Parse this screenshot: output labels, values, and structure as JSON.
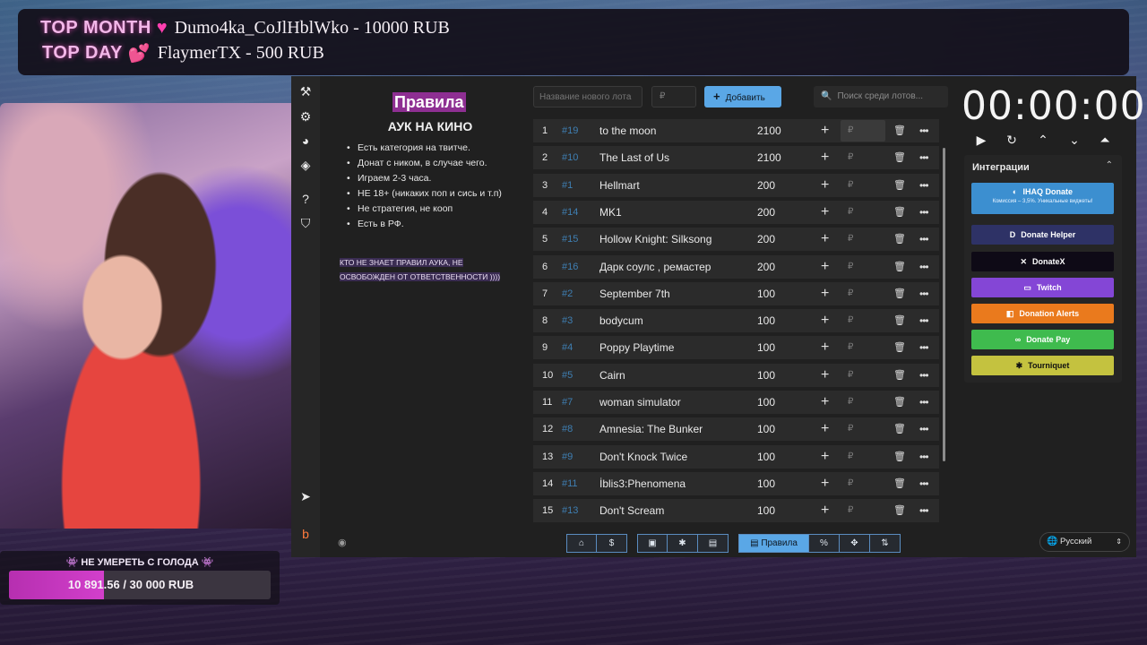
{
  "top_banner": {
    "month_label": "TOP MONTH",
    "month_value": "Dumo4ka_CoJlHblWko - 10000 RUB",
    "day_label": "TOP DAY",
    "day_value": "FlaymerTX - 500 RUB"
  },
  "goal": {
    "title": "👾 НЕ УМЕРЕТЬ С ГОЛОДА 👾",
    "amount_text": "10 891.56 / 30 000 RUB",
    "progress_fraction": 0.363
  },
  "rules": {
    "title": "Правила",
    "subtitle": "АУК НА КИНО",
    "items": [
      "Есть категория на твитче.",
      "Донат с ником, в случае чего.",
      "Играем 2-3 часа.",
      "НЕ 18+ (никаких поп и сись и т.п)",
      "Не стратегия, не кооп",
      "Есть в РФ."
    ],
    "note": "КТО НЕ ЗНАЕТ ПРАВИЛ АУКА, НЕ ОСВОБОЖДЕН ОТ ОТВЕТСТВЕННОСТИ ))))"
  },
  "controls": {
    "lot_name_placeholder": "Название нового лота",
    "lot_sum_placeholder": "₽",
    "add_label": "Добавить",
    "search_placeholder": "Поиск среди лотов..."
  },
  "lots": [
    {
      "index": "1",
      "id": "#19",
      "name": "to the moon",
      "amount": "2100"
    },
    {
      "index": "2",
      "id": "#10",
      "name": "The Last of Us",
      "amount": "2100"
    },
    {
      "index": "3",
      "id": "#1",
      "name": "Hellmart",
      "amount": "200"
    },
    {
      "index": "4",
      "id": "#14",
      "name": "MK1",
      "amount": "200"
    },
    {
      "index": "5",
      "id": "#15",
      "name": "Hollow Knight: Silksong",
      "amount": "200"
    },
    {
      "index": "6",
      "id": "#16",
      "name": "Дарк соулс , ремастер",
      "amount": "200"
    },
    {
      "index": "7",
      "id": "#2",
      "name": "September 7th",
      "amount": "100"
    },
    {
      "index": "8",
      "id": "#3",
      "name": "bodycum",
      "amount": "100"
    },
    {
      "index": "9",
      "id": "#4",
      "name": "Poppy Playtime",
      "amount": "100"
    },
    {
      "index": "10",
      "id": "#5",
      "name": "Cairn",
      "amount": "100"
    },
    {
      "index": "11",
      "id": "#7",
      "name": "woman simulator",
      "amount": "100"
    },
    {
      "index": "12",
      "id": "#8",
      "name": "Amnesia: The Bunker",
      "amount": "100"
    },
    {
      "index": "13",
      "id": "#9",
      "name": "Don't Knock Twice",
      "amount": "100"
    },
    {
      "index": "14",
      "id": "#11",
      "name": "İblis3:Phenomena",
      "amount": "100"
    },
    {
      "index": "15",
      "id": "#13",
      "name": "Don't Scream",
      "amount": "100"
    }
  ],
  "lot_row_labels": {
    "plus": "+",
    "currency": "₽",
    "delete_icon": "🗑",
    "more_icon": "•••"
  },
  "toolbar": {
    "github": "⌂",
    "dollar": "$",
    "save": "▣",
    "bug": "✱",
    "archive": "▤",
    "rules_label": "Правила",
    "percent": "%",
    "move": "✥",
    "sort": "⇅"
  },
  "timer": {
    "display": "00:00:00"
  },
  "integrations": {
    "title": "Интеграции",
    "ihaq_label": "IHAQ Donate",
    "ihaq_sub": "Комиссия – 3,5%. Уникальные виджеты!",
    "items": [
      "Donate Helper",
      "DonateX",
      "Twitch",
      "Donation Alerts",
      "Donate Pay",
      "Tourniquet"
    ]
  },
  "language": {
    "selected": "Русский"
  },
  "colors": {
    "accent_blue": "#5aa7e6",
    "rules_title_bg": "#8e2f92",
    "goal_fill": "#c23abd",
    "twitch": "#8446d6",
    "donation_alerts": "#ea7a1d",
    "donate_pay": "#3fbb4e",
    "tourniquet": "#c4c23f",
    "donate_helper": "#2e3266",
    "donatex": "#0e0a16"
  }
}
